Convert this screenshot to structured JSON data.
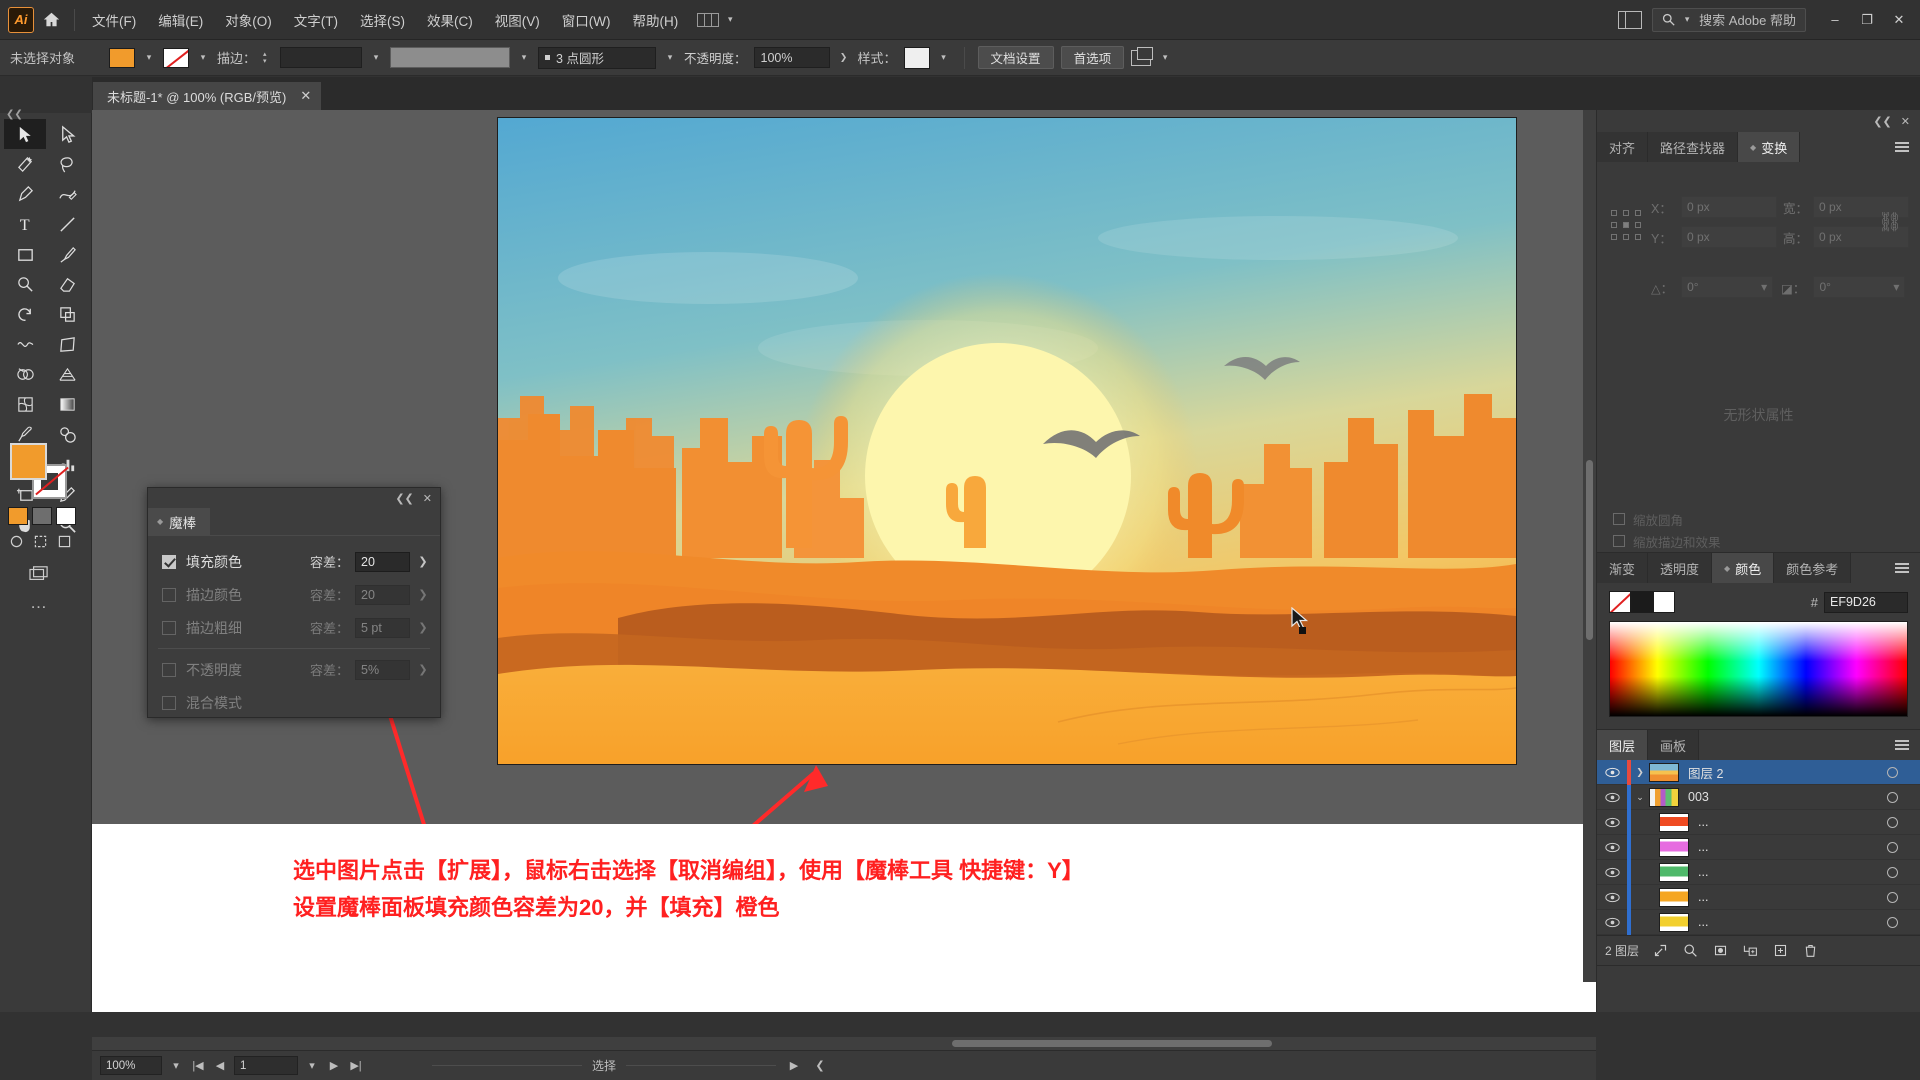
{
  "app": {
    "logo": "Ai",
    "home_icon": "home-icon",
    "workspace_label": "workspace-switcher"
  },
  "menubar": {
    "items": [
      {
        "label": "文件(F)",
        "name": "menu-file"
      },
      {
        "label": "编辑(E)",
        "name": "menu-edit"
      },
      {
        "label": "对象(O)",
        "name": "menu-object"
      },
      {
        "label": "文字(T)",
        "name": "menu-type"
      },
      {
        "label": "选择(S)",
        "name": "menu-select"
      },
      {
        "label": "效果(C)",
        "name": "menu-effect"
      },
      {
        "label": "视图(V)",
        "name": "menu-view"
      },
      {
        "label": "窗口(W)",
        "name": "menu-window"
      },
      {
        "label": "帮助(H)",
        "name": "menu-help"
      }
    ],
    "search_placeholder": "搜索 Adobe 帮助",
    "minimize": "–",
    "restore": "❐",
    "close": "✕"
  },
  "controlbar": {
    "selection_status": "未选择对象",
    "fill_color": "#F19B2C",
    "stroke_label": "描边：",
    "stroke_weight": "",
    "brush_profile": "3 点圆形",
    "opacity_label": "不透明度：",
    "opacity_value": "100%",
    "style_label": "样式：",
    "doc_setup_button": "文档设置",
    "preferences_button": "首选项",
    "arrange_label": "arrange-documents"
  },
  "document_tab": {
    "title": "未标题-1* @ 100% (RGB/预览)",
    "close": "✕"
  },
  "toolbar": {
    "tools": [
      {
        "name": "selection-tool",
        "active": true
      },
      {
        "name": "direct-selection-tool",
        "active": false
      },
      {
        "name": "magic-wand-tool",
        "active": false
      },
      {
        "name": "lasso-tool",
        "active": false
      },
      {
        "name": "pen-tool",
        "active": false
      },
      {
        "name": "curvature-tool",
        "active": false
      },
      {
        "name": "type-tool",
        "active": false
      },
      {
        "name": "line-segment-tool",
        "active": false
      },
      {
        "name": "rectangle-tool",
        "active": false
      },
      {
        "name": "paintbrush-tool",
        "active": false
      },
      {
        "name": "shaper-tool",
        "active": false
      },
      {
        "name": "eraser-tool",
        "active": false
      },
      {
        "name": "rotate-tool",
        "active": false
      },
      {
        "name": "scale-tool",
        "active": false
      },
      {
        "name": "width-tool",
        "active": false
      },
      {
        "name": "free-transform-tool",
        "active": false
      },
      {
        "name": "shape-builder-tool",
        "active": false
      },
      {
        "name": "perspective-grid-tool",
        "active": false
      },
      {
        "name": "mesh-tool",
        "active": false
      },
      {
        "name": "gradient-tool",
        "active": false
      },
      {
        "name": "eyedropper-tool",
        "active": false
      },
      {
        "name": "blend-tool",
        "active": false
      },
      {
        "name": "symbol-sprayer-tool",
        "active": false
      },
      {
        "name": "column-graph-tool",
        "active": false
      },
      {
        "name": "artboard-tool",
        "active": false
      },
      {
        "name": "slice-tool",
        "active": false
      },
      {
        "name": "hand-tool",
        "active": false
      },
      {
        "name": "zoom-tool",
        "active": false
      }
    ],
    "fill_color": "#F19B2C",
    "stroke_color": "#FFFFFF",
    "more_tools": "…"
  },
  "magicwand_panel": {
    "title": "魔棒",
    "close": "✕",
    "collapse": "❮❮",
    "rows": [
      {
        "label": "填充颜色",
        "checked": true,
        "enabled": true,
        "tol_label": "容差：",
        "tol_value": "20"
      },
      {
        "label": "描边颜色",
        "checked": false,
        "enabled": false,
        "tol_label": "容差：",
        "tol_value": "20"
      },
      {
        "label": "描边粗细",
        "checked": false,
        "enabled": false,
        "tol_label": "容差：",
        "tol_value": "5 pt"
      },
      {
        "label": "不透明度",
        "checked": false,
        "enabled": false,
        "tol_label": "容差：",
        "tol_value": "5%"
      },
      {
        "label": "混合模式",
        "checked": false,
        "enabled": false,
        "tol_label": "",
        "tol_value": ""
      }
    ]
  },
  "transform_panel": {
    "tabs": [
      {
        "label": "对齐",
        "active": false
      },
      {
        "label": "路径查找器",
        "active": false
      },
      {
        "label": "变换",
        "active": true
      }
    ],
    "fields": [
      {
        "label": "X：",
        "value": "0 px"
      },
      {
        "label": "宽：",
        "value": "0 px"
      },
      {
        "label": "Y：",
        "value": "0 px"
      },
      {
        "label": "高：",
        "value": "0 px"
      }
    ],
    "angle_label": "△：",
    "angle_value": "0°",
    "shear_label": "◪：",
    "shear_value": "0°",
    "empty_text": "无形状属性",
    "checks": [
      {
        "label": "缩放圆角"
      },
      {
        "label": "缩放描边和效果"
      }
    ]
  },
  "color_panel": {
    "tabs": [
      {
        "label": "渐变",
        "active": false
      },
      {
        "label": "透明度",
        "active": false
      },
      {
        "label": "颜色",
        "active": true
      },
      {
        "label": "颜色参考",
        "active": false
      }
    ],
    "hash": "#",
    "hex_value": "EF9D26"
  },
  "layers_panel": {
    "tabs": [
      {
        "label": "图层",
        "active": true
      },
      {
        "label": "画板",
        "active": false
      }
    ],
    "rows": [
      {
        "name": "图层 2",
        "selected": true,
        "indent": 0,
        "twirl": "❯",
        "color": "#e84a3e",
        "thumb_kind": "art"
      },
      {
        "name": "003",
        "selected": false,
        "indent": 1,
        "twirl": "⌄",
        "color": "#2f6fd0",
        "thumb_kind": "group"
      },
      {
        "name": "...",
        "selected": false,
        "indent": 2,
        "twirl": "",
        "color": "#2f6fd0",
        "thumb_kind": "red"
      },
      {
        "name": "...",
        "selected": false,
        "indent": 2,
        "twirl": "",
        "color": "#2f6fd0",
        "thumb_kind": "magenta"
      },
      {
        "name": "...",
        "selected": false,
        "indent": 2,
        "twirl": "",
        "color": "#2f6fd0",
        "thumb_kind": "green"
      },
      {
        "name": "...",
        "selected": false,
        "indent": 2,
        "twirl": "",
        "color": "#2f6fd0",
        "thumb_kind": "orange"
      },
      {
        "name": "...",
        "selected": false,
        "indent": 2,
        "twirl": "",
        "color": "#2f6fd0",
        "thumb_kind": "yellow"
      }
    ],
    "count_text": "2 图层",
    "footer_icons": [
      "locate-object-icon",
      "search-icon",
      "make-mask-icon",
      "new-sublayer-icon",
      "new-layer-icon",
      "delete-layer-icon"
    ]
  },
  "statusbar": {
    "zoom": "100%",
    "page": "1",
    "status_text": "选择"
  },
  "annotation": {
    "line1": "选中图片点击【扩展】，鼠标右击选择【取消编组】，使用【魔棒工具 快捷键：Y】",
    "line2": "设置魔棒面板填充颜色容差为20，并【填充】橙色",
    "color": "#FF2020"
  },
  "artwork": {
    "description": "desert-sunset-illustration",
    "sun_color": "#FDF7B0",
    "sand_color": "#F7A230",
    "sky_top": "#5AA8D0"
  }
}
